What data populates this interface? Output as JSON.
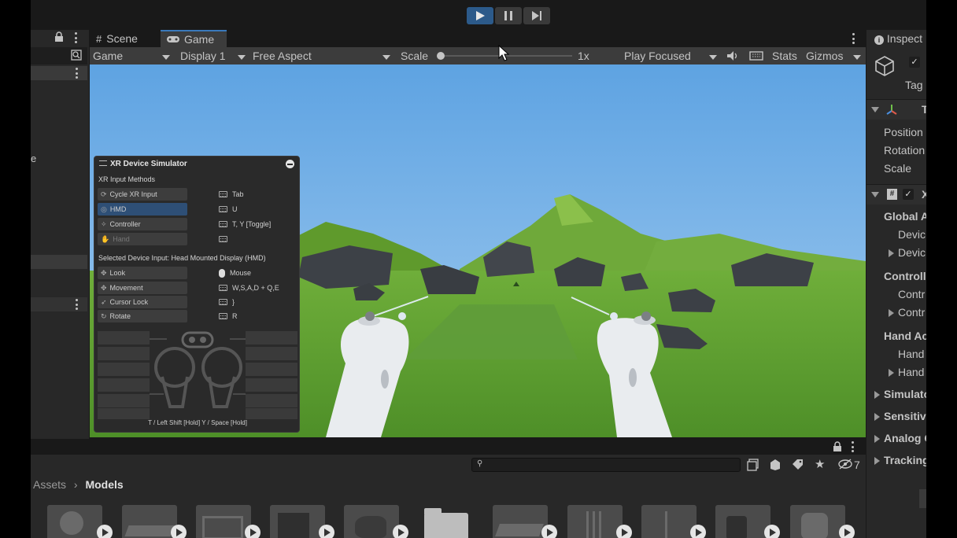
{
  "toolbar": {
    "play_icon": "play-icon",
    "pause_icon": "pause-icon",
    "step_icon": "step-icon"
  },
  "tabs": [
    {
      "label": "Scene",
      "icon": "hash-icon"
    },
    {
      "label": "Game",
      "icon": "gamepad-icon"
    }
  ],
  "game_toolbar": {
    "mode": "Game",
    "display": "Display 1",
    "aspect": "Free Aspect",
    "scale_label": "Scale",
    "scale_value": "1x",
    "play_mode": "Play Focused",
    "stats": "Stats",
    "gizmos": "Gizmos"
  },
  "hierarchy": {
    "fragment": "e"
  },
  "simulator": {
    "title": "XR Device Simulator",
    "input_methods_heading": "XR Input Methods",
    "methods": [
      {
        "label": "Cycle XR Input",
        "key": "Tab",
        "state": "normal"
      },
      {
        "label": "HMD",
        "key": "U",
        "state": "selected"
      },
      {
        "label": "Controller",
        "key": "T, Y [Toggle]",
        "state": "normal"
      },
      {
        "label": "Hand",
        "key": "",
        "state": "disabled"
      }
    ],
    "selected_heading": "Selected Device Input: Head Mounted Display (HMD)",
    "actions": [
      {
        "label": "Look",
        "key": "Mouse",
        "key_icon": "mouse-icon"
      },
      {
        "label": "Movement",
        "key": "W,S,A,D + Q,E",
        "key_icon": "keyboard-icon"
      },
      {
        "label": "Cursor Lock",
        "key": "}",
        "key_icon": "keyboard-icon"
      },
      {
        "label": "Rotate",
        "key": "R",
        "key_icon": "keyboard-icon"
      }
    ],
    "footer": "T / Left Shift [Hold]  Y / Space [Hold]"
  },
  "inspector": {
    "tab": "Inspect",
    "tag": "Tag",
    "transform_title": "T",
    "position": "Position",
    "rotation": "Rotation",
    "scale": "Scale",
    "component_title": "X",
    "rows": [
      {
        "label": "Global A",
        "indent": 0,
        "expander": false
      },
      {
        "label": "Devic",
        "indent": 1,
        "expander": false
      },
      {
        "label": "Devic",
        "indent": 1,
        "expander": true
      },
      {
        "label": "Controll",
        "indent": 0,
        "expander": false
      },
      {
        "label": "Contr",
        "indent": 1,
        "expander": false
      },
      {
        "label": "Contr",
        "indent": 1,
        "expander": true
      },
      {
        "label": "Hand Ac",
        "indent": 0,
        "expander": false
      },
      {
        "label": "Hand",
        "indent": 1,
        "expander": false
      },
      {
        "label": "Hand",
        "indent": 1,
        "expander": true
      },
      {
        "label": "Simulato",
        "indent": 0,
        "expander": true,
        "bold": true
      },
      {
        "label": "Sensitiv",
        "indent": 0,
        "expander": true,
        "bold": true
      },
      {
        "label": "Analog C",
        "indent": 0,
        "expander": true,
        "bold": true
      },
      {
        "label": "Tracking",
        "indent": 0,
        "expander": true,
        "bold": true
      }
    ]
  },
  "project": {
    "breadcrumb": [
      "Assets",
      "Models"
    ],
    "search_placeholder": "",
    "hidden_count": "7",
    "assets": [
      {
        "kind": "model",
        "has_play": true
      },
      {
        "kind": "model",
        "has_play": true
      },
      {
        "kind": "model",
        "has_play": true
      },
      {
        "kind": "model",
        "has_play": true
      },
      {
        "kind": "model",
        "has_play": true
      },
      {
        "kind": "folder",
        "has_play": false
      },
      {
        "kind": "model",
        "has_play": true
      },
      {
        "kind": "model",
        "has_play": true
      },
      {
        "kind": "model",
        "has_play": true
      },
      {
        "kind": "model",
        "has_play": true
      },
      {
        "kind": "model",
        "has_play": true
      }
    ]
  },
  "colors": {
    "accent": "#2c5a8a",
    "panel": "#282828",
    "toolbar": "#3c3c3c",
    "sky": "#79b3e9",
    "grass": "#5a9a2e"
  }
}
